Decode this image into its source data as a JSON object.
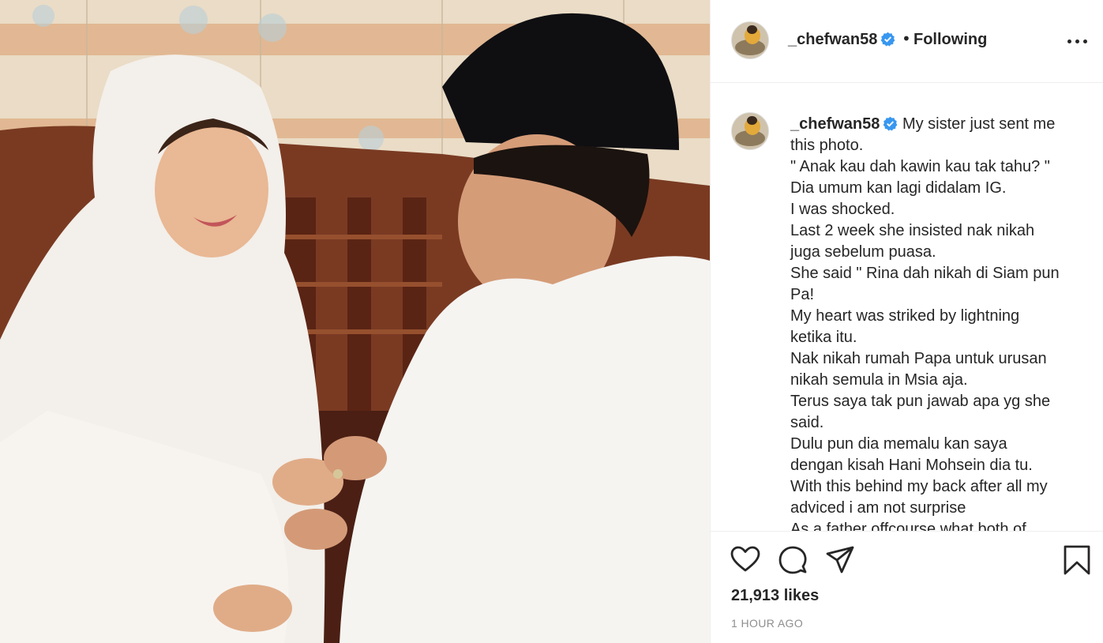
{
  "post": {
    "photo_icon": "wedding-photo",
    "header": {
      "username": "_chefwan58",
      "separator": "•",
      "follow_label": "Following"
    },
    "caption": {
      "username": "_chefwan58",
      "lines": [
        "My sister just sent me",
        "this photo.",
        "\" Anak kau dah kawin kau tak tahu? \"",
        "Dia umum kan lagi didalam IG.",
        "I was shocked.",
        "Last 2 week she insisted nak nikah",
        "juga sebelum puasa.",
        "She said \" Rina dah nikah di Siam pun",
        "Pa!",
        "My heart was striked by lightning",
        "ketika itu.",
        "Nak nikah rumah Papa untuk urusan",
        "nikah semula in Msia aja.",
        "Terus saya tak pun jawab apa yg she",
        "said.",
        "Dulu pun dia memalu kan saya",
        "dengan kisah Hani Mohsein dia tu.",
        "With this behind my back after all my",
        "adviced i am not surprise",
        "As a father offcourse what both of"
      ]
    },
    "likes": "21,913 likes",
    "timestamp": "1 HOUR AGO",
    "colors": {
      "verified": "#3897f0",
      "text": "#262626",
      "muted": "#8e8e8e",
      "divider": "#efefef"
    }
  }
}
